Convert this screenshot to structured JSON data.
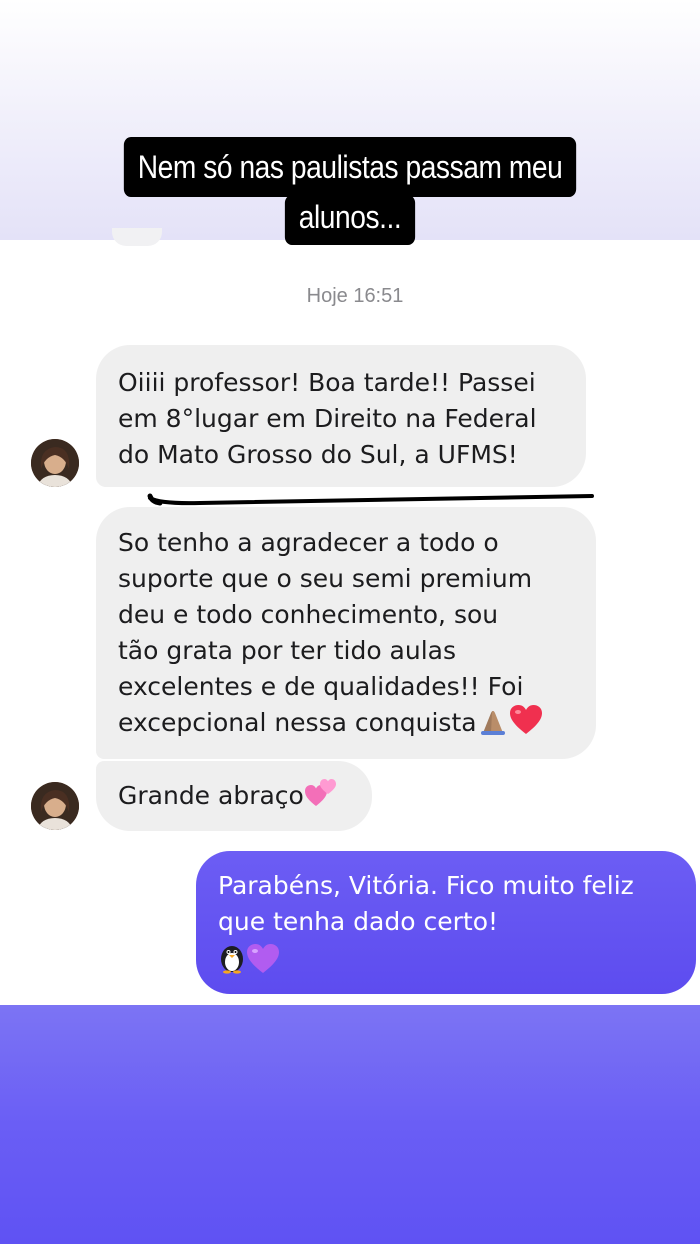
{
  "caption": {
    "line1": "Nem só nas paulistas passam meu",
    "line2": "alunos..."
  },
  "chat": {
    "timestamp": "Hoje 16:51",
    "messages": [
      {
        "side": "incoming",
        "text": "Oiiii professor! Boa tarde!! Passei\nem 8°lugar em Direito na Federal\ndo Mato Grosso do Sul, a UFMS!"
      },
      {
        "side": "incoming",
        "text": "So tenho a agradecer a todo o\nsuporte que o seu semi premium\ndeu e todo conhecimento, sou\ntão grata por ter tido aulas\nexcelentes e de qualidades!! Foi\nexcepcional nessa conquista",
        "emojis": [
          "praying-hands",
          "red-heart"
        ]
      },
      {
        "side": "incoming",
        "text": "Grande abraço",
        "emojis": [
          "two-hearts"
        ]
      },
      {
        "side": "outgoing",
        "text": "Parabéns, Vitória. Fico muito feliz\nque tenha dado certo!",
        "emojis": [
          "penguin",
          "purple-heart"
        ]
      }
    ]
  },
  "colors": {
    "incoming_bubble": "#efefef",
    "outgoing_bubble": "#6356f2",
    "caption_bg": "#000000",
    "bottom_band": "#6a5ef5"
  }
}
